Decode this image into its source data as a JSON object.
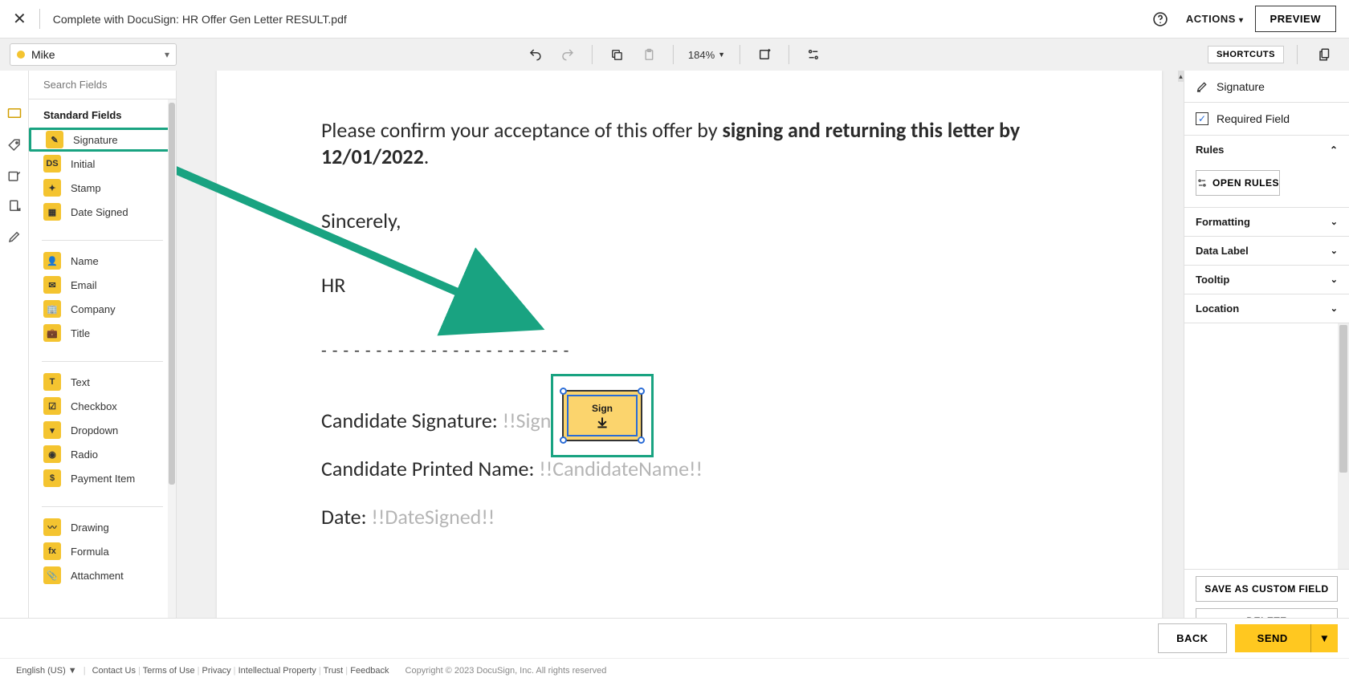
{
  "header": {
    "doc_title": "Complete with DocuSign: HR Offer Gen Letter RESULT.pdf",
    "actions_label": "ACTIONS",
    "preview_label": "PREVIEW"
  },
  "toolbar": {
    "recipient": "Mike",
    "zoom": "184%",
    "shortcuts": "SHORTCUTS"
  },
  "search": {
    "placeholder": "Search Fields"
  },
  "panel": {
    "heading": "Standard Fields",
    "fields_group1": [
      {
        "icon": "✎",
        "label": "Signature"
      },
      {
        "icon": "DS",
        "label": "Initial"
      },
      {
        "icon": "✦",
        "label": "Stamp"
      },
      {
        "icon": "▦",
        "label": "Date Signed"
      }
    ],
    "fields_group2": [
      {
        "icon": "👤",
        "label": "Name"
      },
      {
        "icon": "✉",
        "label": "Email"
      },
      {
        "icon": "🏢",
        "label": "Company"
      },
      {
        "icon": "💼",
        "label": "Title"
      }
    ],
    "fields_group3": [
      {
        "icon": "T",
        "label": "Text"
      },
      {
        "icon": "☑",
        "label": "Checkbox"
      },
      {
        "icon": "▾",
        "label": "Dropdown"
      },
      {
        "icon": "◉",
        "label": "Radio"
      },
      {
        "icon": "$",
        "label": "Payment Item"
      }
    ],
    "fields_group4": [
      {
        "icon": "〰",
        "label": "Drawing"
      },
      {
        "icon": "fx",
        "label": "Formula"
      },
      {
        "icon": "📎",
        "label": "Attachment"
      }
    ]
  },
  "document": {
    "para_prefix": "Please confirm your acceptance of this offer by ",
    "para_bold": "signing and returning this letter by 12/01/2022",
    "para_suffix": ".",
    "sincerely": "Sincerely,",
    "hr": "HR",
    "dashes": "- - - - - - - - - - - - - - - - - - - - - - -",
    "cand_sig_label": "Candidate Signature: ",
    "cand_sig_placeholder": "!!SignHere!!",
    "cand_name_label": "Candidate Printed Name: ",
    "cand_name_placeholder": "!!CandidateName!!",
    "date_label": "Date: ",
    "date_placeholder": "!!DateSigned!!",
    "sign_tag_text": "Sign"
  },
  "props": {
    "type_label": "Signature",
    "required_label": "Required Field",
    "rules_heading": "Rules",
    "open_rules": "OPEN RULES",
    "formatting": "Formatting",
    "data_label": "Data Label",
    "tooltip": "Tooltip",
    "location": "Location",
    "save_custom": "SAVE AS CUSTOM FIELD",
    "delete": "DELETE"
  },
  "bottom": {
    "back": "BACK",
    "send": "SEND"
  },
  "footer": {
    "lang": "English (US)",
    "links": [
      "Contact Us",
      "Terms of Use",
      "Privacy",
      "Intellectual Property",
      "Trust",
      "Feedback"
    ],
    "copyright": "Copyright © 2023 DocuSign, Inc. All rights reserved"
  }
}
